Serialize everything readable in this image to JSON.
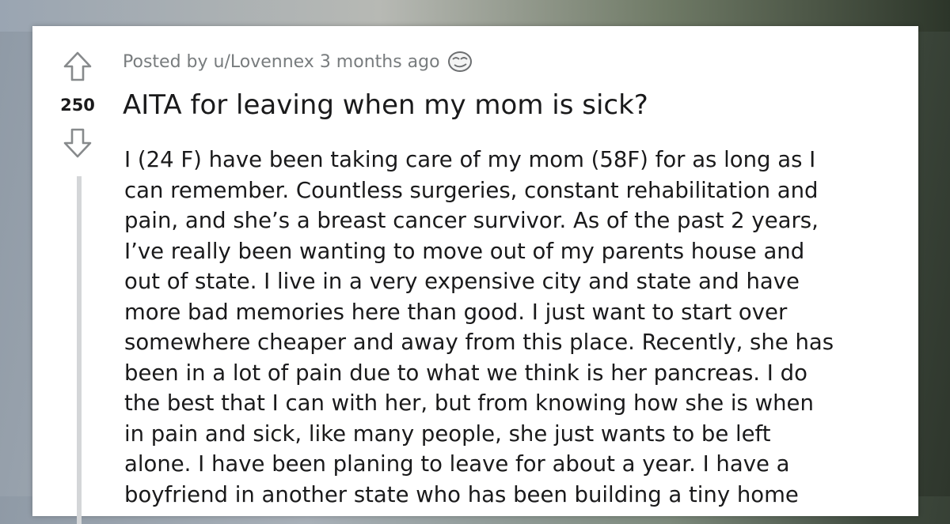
{
  "post": {
    "posted_by_prefix": "Posted by",
    "author": "u/Lovennex",
    "time_ago": "3 months ago",
    "score": "250",
    "title": "AITA for leaving when my mom is sick?",
    "body_lines": [
      "I (24 F) have been taking care of my mom (58F) for as long as I",
      "can remember. Countless surgeries, constant rehabilitation and",
      "pain, and she’s a breast cancer survivor. As of the past 2 years,",
      "I’ve really been wanting to move out of my parents house and",
      "out of state. I live in a very expensive city and state and have",
      "more bad memories here than good. I just want to start over",
      "somewhere cheaper and away from this place. Recently, she has",
      "been in a lot of pain due to what we think is her pancreas. I do",
      "the best that I can with her, but from knowing how she is when",
      "in pain and sick, like many people, she just wants to be left",
      "alone. I have been planing to leave for about a year. I have a",
      "boyfriend in another state who has been building a tiny home"
    ]
  },
  "icons": {
    "upvote": "upvote-arrow-icon",
    "downvote": "downvote-arrow-icon",
    "award": "award-face-icon"
  },
  "colors": {
    "text": "#1a1a1b",
    "meta": "#787c7e",
    "arrow": "#878a8c",
    "thread_line": "#d4d6d8"
  }
}
